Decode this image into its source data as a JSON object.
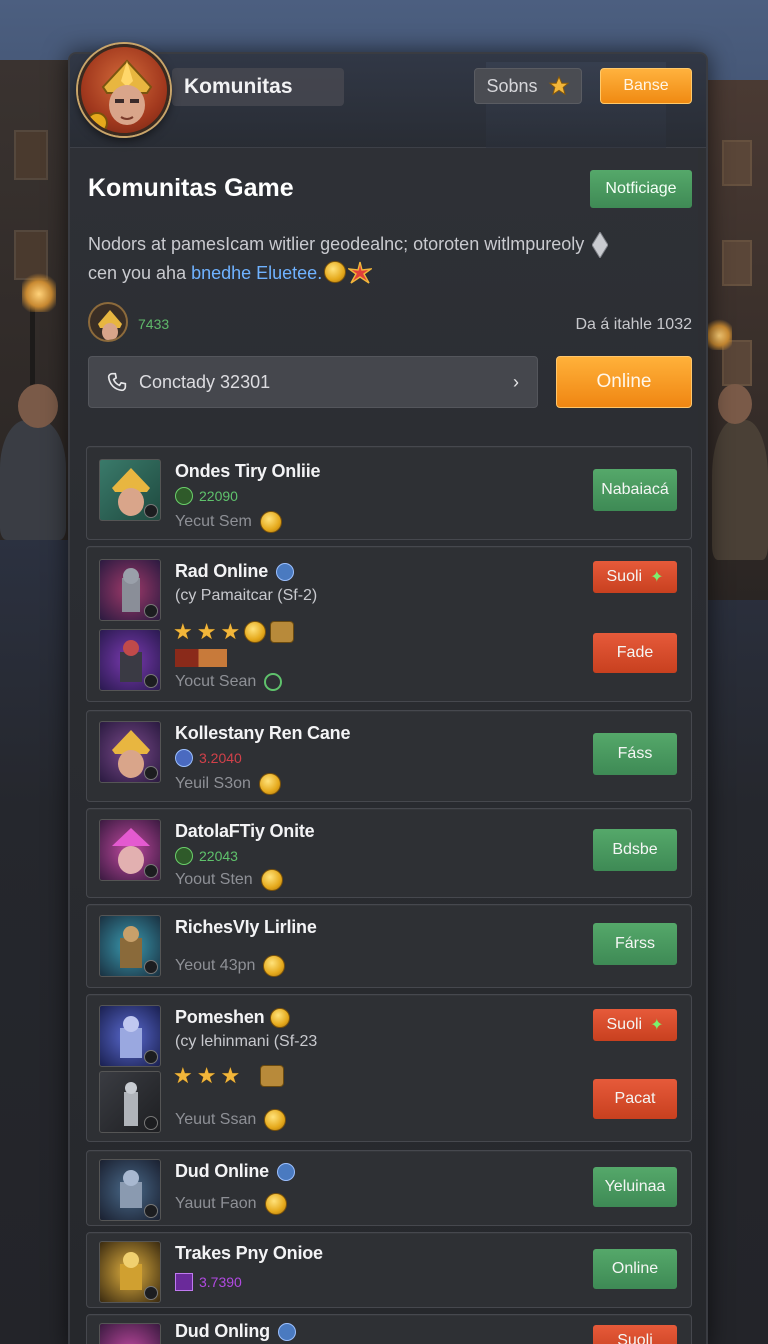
{
  "header": {
    "title": "Komunitas",
    "gray_button": "Sobns",
    "orange_button": "Banse"
  },
  "section": {
    "title": "Komunitas Game",
    "notify_button": "Notficiage",
    "description_line1": "Nodors at pamesIcam witlier geodealnc; otoroten witlmpureoly",
    "description_line2_prefix": "cen you aha ",
    "description_link": "bnedhe Eluetee."
  },
  "profile": {
    "number": "7433",
    "right_text": "Da á itahle 1032"
  },
  "contact": {
    "label": "Conctady 32301",
    "online_button": "Online"
  },
  "games": [
    {
      "name": "Ondes Tiry Onliie",
      "meta": "22090",
      "meta_color": "#5fc26c",
      "sub": "Yecut Sem",
      "button": "Nabaiacá",
      "button_color": "green"
    },
    {
      "name": "Rad Online",
      "meta": "(cy Pamaitcar  (Sf-2)",
      "meta_color": "#c8c9ce",
      "button_top": "Suoli",
      "button": "Fade",
      "button_color": "red",
      "sub": "Yocut Sean"
    },
    {
      "name": "Kollestany Ren Cane",
      "meta": "3.2040",
      "meta_color": "#d2414a",
      "sub": "Yeuil S3on",
      "button": "Fáss",
      "button_color": "green"
    },
    {
      "name": "DatolaFTiy Onite",
      "meta": "22043",
      "meta_color": "#5fc26c",
      "sub": "Yoout Sten",
      "button": "Bdsbe",
      "button_color": "green"
    },
    {
      "name": "RichesVIy Lirline",
      "sub": "Yeout 43pn",
      "button": "Fárss",
      "button_color": "green"
    },
    {
      "name": "Pomeshen",
      "meta": "(cy lehinmani  (Sf-23",
      "meta_color": "#c8c9ce",
      "button_top": "Suoli",
      "button": "Pacat",
      "button_color": "red",
      "sub": "Yeuut Ssan"
    },
    {
      "name": "Dud Online",
      "sub": "Yauut Faon",
      "button": "Yeluinaa",
      "button_color": "green"
    },
    {
      "name": "Trakes Pny Onioe",
      "meta": "3.7390",
      "meta_color": "#b04ae0",
      "button": "Online",
      "button_color": "green"
    },
    {
      "name": "Dud Onling",
      "button": "Suoli",
      "button_color": "red"
    }
  ],
  "colors": {
    "accent_orange": "#f5a020",
    "button_green": "#4a9a60",
    "button_red": "#d84a2a",
    "panel_bg": "#2c2e33"
  }
}
